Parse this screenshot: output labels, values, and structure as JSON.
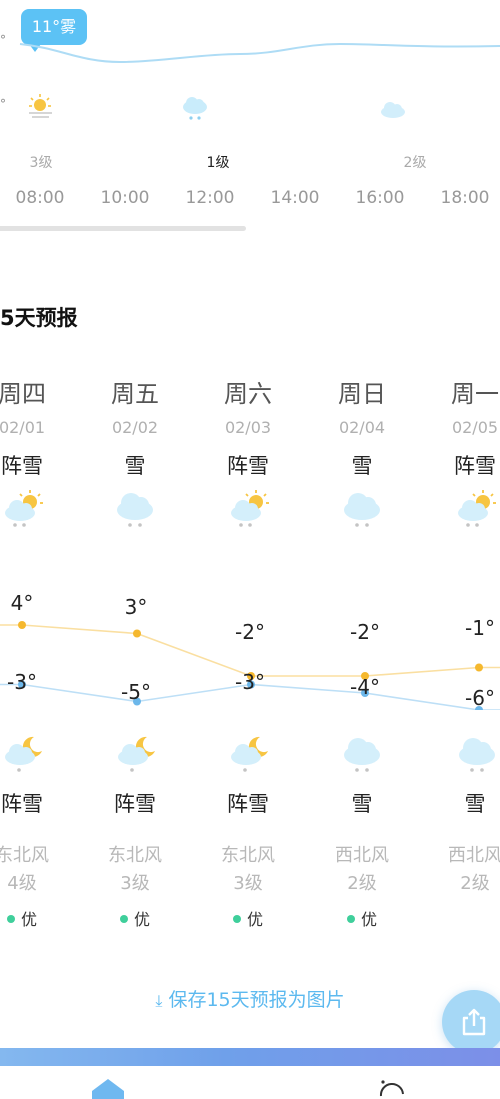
{
  "hourly": {
    "current_badge": "11°雾",
    "edge_degree_1": "°",
    "edge_degree_2": "°",
    "wind_levels": [
      {
        "label": "3级",
        "active": false
      },
      {
        "label": "1级",
        "active": true
      },
      {
        "label": "2级",
        "active": false
      }
    ],
    "hours": [
      "08:00",
      "10:00",
      "12:00",
      "14:00",
      "16:00",
      "18:00"
    ],
    "icons": [
      "sun-haze-icon",
      "cloud-snow-icon",
      "cloud-icon"
    ]
  },
  "forecast": {
    "title": "5天预报",
    "save_label": "保存15天预报为图片",
    "days": [
      {
        "weekday": "周四",
        "date": "02/01",
        "day_cond": "阵雪",
        "high": "4°",
        "low": "-3°",
        "night_cond": "阵雪",
        "wind_dir": "东北风",
        "wind_level": "4级",
        "aqi": "优",
        "day_icon": "partly-sunny-snow-icon",
        "night_icon": "moon-cloud-snow-icon"
      },
      {
        "weekday": "周五",
        "date": "02/02",
        "day_cond": "雪",
        "high": "3°",
        "low": "-5°",
        "night_cond": "阵雪",
        "wind_dir": "东北风",
        "wind_level": "3级",
        "aqi": "优",
        "day_icon": "cloud-snow-icon",
        "night_icon": "moon-cloud-snow-icon"
      },
      {
        "weekday": "周六",
        "date": "02/03",
        "day_cond": "阵雪",
        "high": "-2°",
        "low": "-3°",
        "night_cond": "阵雪",
        "wind_dir": "东北风",
        "wind_level": "3级",
        "aqi": "优",
        "day_icon": "partly-sunny-snow-icon",
        "night_icon": "moon-cloud-snow-icon"
      },
      {
        "weekday": "周日",
        "date": "02/04",
        "day_cond": "雪",
        "high": "-2°",
        "low": "-4°",
        "night_cond": "雪",
        "wind_dir": "西北风",
        "wind_level": "2级",
        "aqi": "优",
        "day_icon": "cloud-snow-icon",
        "night_icon": "cloud-snow-icon"
      },
      {
        "weekday": "周一",
        "date": "02/05",
        "day_cond": "阵雪",
        "high": "-1°",
        "low": "-6°",
        "night_cond": "雪",
        "wind_dir": "西北风",
        "wind_level": "2级",
        "aqi": "",
        "day_icon": "partly-sunny-snow-icon",
        "night_icon": "cloud-snow-icon"
      }
    ]
  },
  "colors": {
    "accent": "#5cc2f5",
    "high_line": "#f5b82e",
    "low_line": "#6cb7ea",
    "aqi_good": "#3fcf9b",
    "link": "#5cb9ef"
  },
  "tabbar_icons": [
    "home-icon",
    "discover-icon"
  ]
}
